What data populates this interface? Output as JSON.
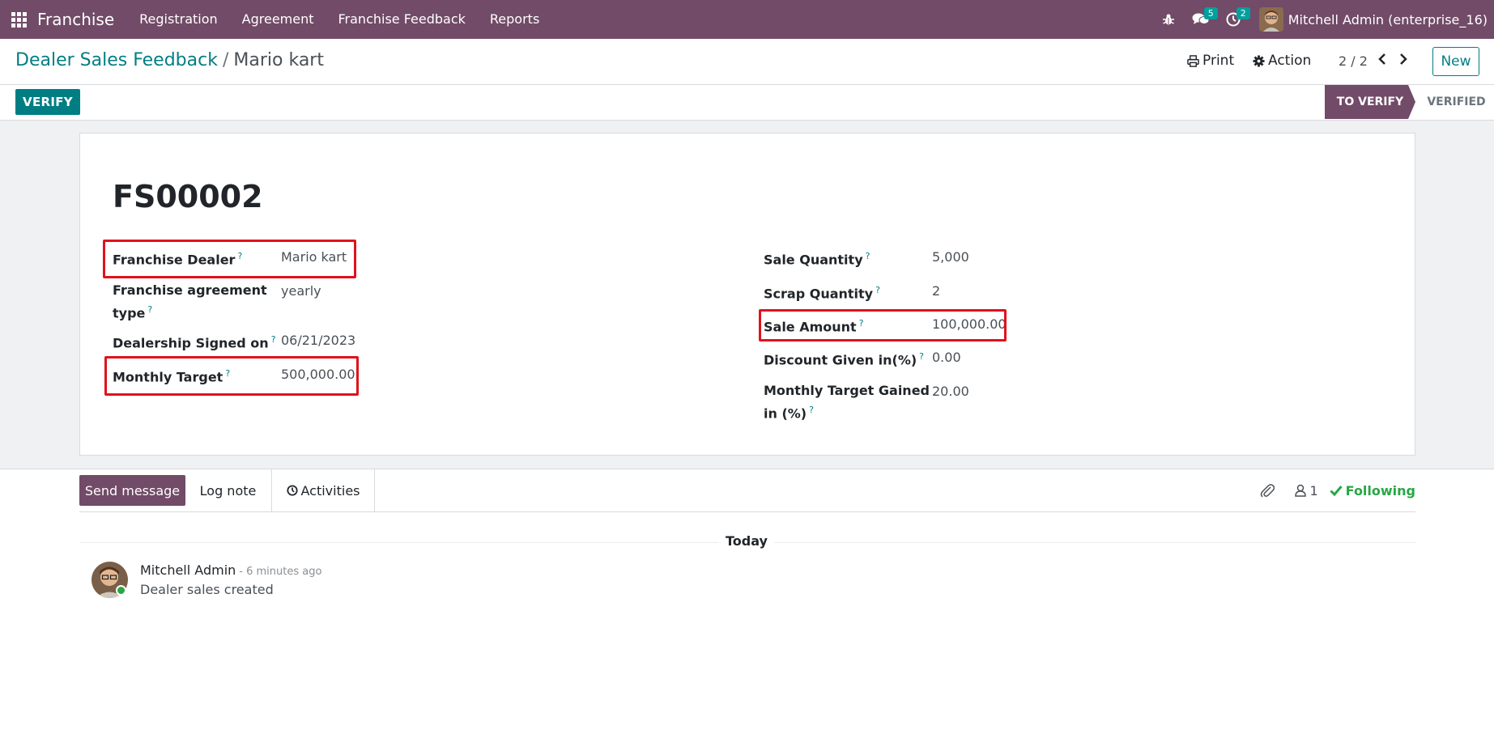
{
  "navbar": {
    "app_name": "Franchise",
    "menu": [
      "Registration",
      "Agreement",
      "Franchise Feedback",
      "Reports"
    ],
    "messages_count": "5",
    "activities_count": "2",
    "user_name": "Mitchell Admin (enterprise_16)"
  },
  "control_panel": {
    "breadcrumb_parent": "Dealer Sales Feedback",
    "breadcrumb_separator": "/",
    "breadcrumb_current": "Mario kart",
    "print_label": "Print",
    "action_label": "Action",
    "pager": "2 / 2",
    "new_label": "New"
  },
  "statusbar": {
    "verify_label": "VERIFY",
    "stages": [
      "TO VERIFY",
      "VERIFIED"
    ],
    "active_stage": "TO VERIFY"
  },
  "form": {
    "record_name": "FS00002",
    "left_fields": [
      {
        "label": "Franchise Dealer",
        "value": "Mario kart"
      },
      {
        "label_line1": "Franchise agreement",
        "label_line2": "type",
        "value": "yearly"
      },
      {
        "label": "Dealership Signed on",
        "value": "06/21/2023"
      },
      {
        "label": "Monthly Target",
        "value": "500,000.00"
      }
    ],
    "right_fields": [
      {
        "label": "Sale Quantity",
        "value": "5,000"
      },
      {
        "label": "Scrap Quantity",
        "value": "2"
      },
      {
        "label": "Sale Amount",
        "value": "100,000.00"
      },
      {
        "label": "Discount Given in(%)",
        "value": "0.00"
      },
      {
        "label_line1": "Monthly Target Gained",
        "label_line2": "in (%)",
        "value": "20.00"
      }
    ],
    "help_marker": "?"
  },
  "chatter": {
    "send_message": "Send message",
    "log_note": "Log note",
    "activities": "Activities",
    "followers_count": "1",
    "following": "Following",
    "date_separator": "Today",
    "message": {
      "author": "Mitchell Admin",
      "time": "- 6 minutes ago",
      "body": "Dealer sales created"
    }
  },
  "colors": {
    "brand": "#714b67",
    "accent": "#017e84",
    "highlight": "#e0121d",
    "following": "#28a745"
  }
}
